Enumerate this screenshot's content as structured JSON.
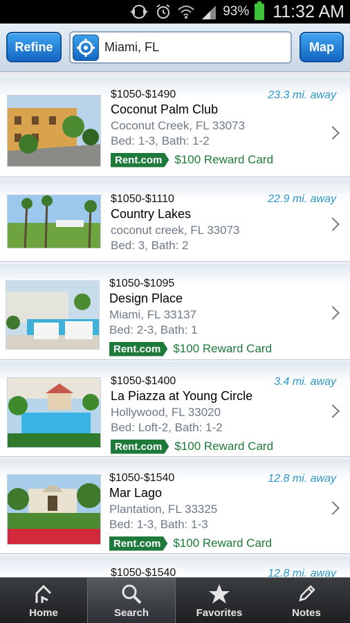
{
  "status_bar": {
    "battery_pct": "93%",
    "time": "11:32 AM"
  },
  "header": {
    "refine_label": "Refine",
    "search_value": "Miami, FL",
    "map_label": "Map"
  },
  "listings": [
    {
      "price": "$1050-$1490",
      "name": "Coconut Palm Club",
      "address": "Coconut Creek, FL 33073",
      "beds": "Bed: 1-3, Bath: 1-2",
      "distance": "23.3 mi. away",
      "badge": "Rent.com",
      "reward": "$100 Reward Card"
    },
    {
      "price": "$1050-$1110",
      "name": "Country Lakes",
      "address": "coconut creek, FL 33073",
      "beds": "Bed: 3, Bath: 2",
      "distance": "22.9 mi. away",
      "badge": "",
      "reward": ""
    },
    {
      "price": "$1050-$1095",
      "name": "Design Place",
      "address": "Miami, FL 33137",
      "beds": "Bed: 2-3, Bath: 1",
      "distance": "",
      "badge": "Rent.com",
      "reward": "$100 Reward Card"
    },
    {
      "price": "$1050-$1400",
      "name": "La Piazza at Young Circle",
      "address": "Hollywood, FL 33020",
      "beds": "Bed: Loft-2, Bath: 1-2",
      "distance": "3.4 mi. away",
      "badge": "Rent.com",
      "reward": "$100 Reward Card"
    },
    {
      "price": "$1050-$1540",
      "name": "Mar Lago",
      "address": "Plantation, FL 33325",
      "beds": "Bed: 1-3, Bath: 1-3",
      "distance": "12.8 mi. away",
      "badge": "Rent.com",
      "reward": "$100 Reward Card"
    },
    {
      "price": "$1050-$1540",
      "name": "",
      "address": "",
      "beds": "",
      "distance": "12.8 mi. away",
      "badge": "",
      "reward": ""
    }
  ],
  "tabs": [
    {
      "label": "Home",
      "icon": "home-icon"
    },
    {
      "label": "Search",
      "icon": "search-icon",
      "active": true
    },
    {
      "label": "Favorites",
      "icon": "star-icon"
    },
    {
      "label": "Notes",
      "icon": "pencil-icon"
    }
  ],
  "colors": {
    "accent": "#1466c2",
    "reward_green": "#1d7a3a",
    "distance_blue": "#2a97c9"
  }
}
